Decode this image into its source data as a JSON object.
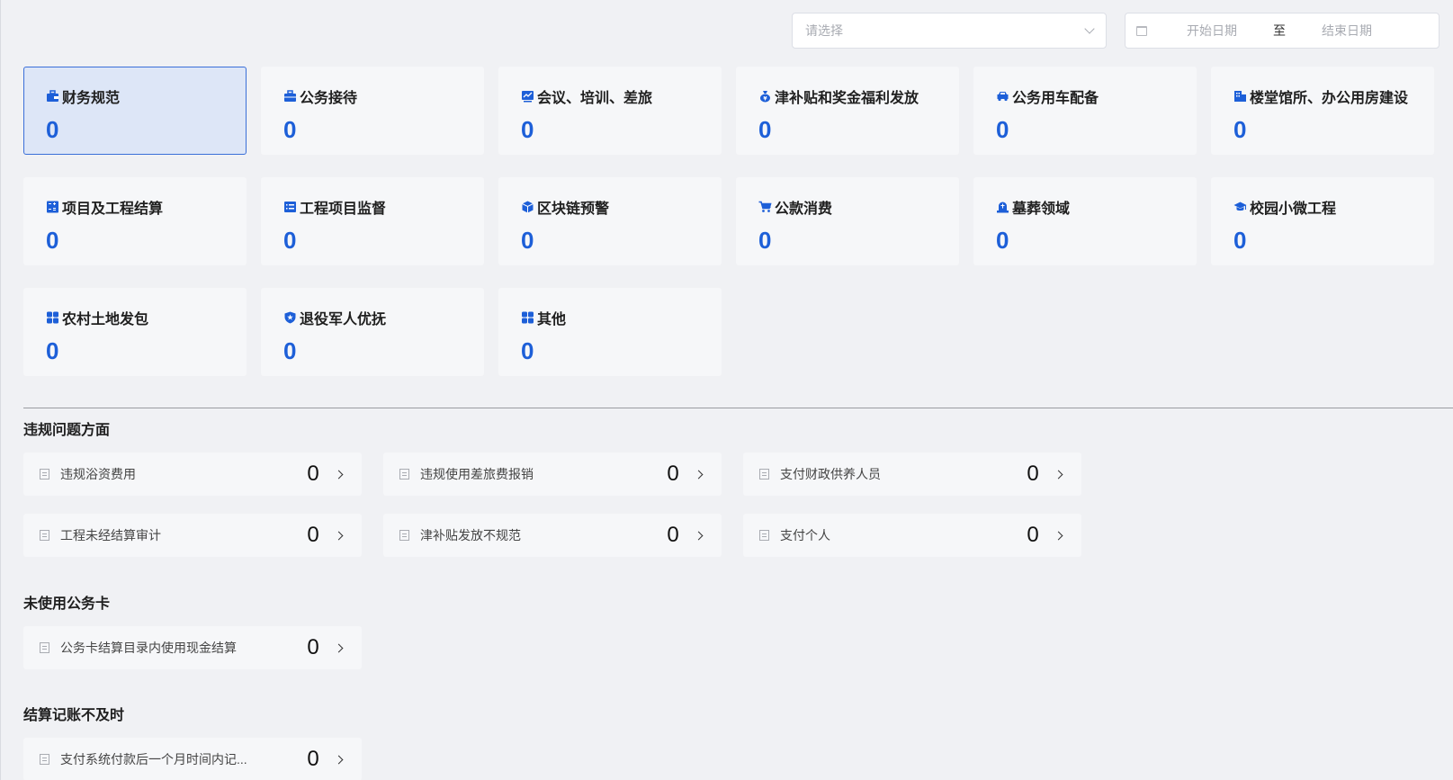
{
  "filters": {
    "select_placeholder": "请选择",
    "start_date_placeholder": "开始日期",
    "range_separator": "至",
    "end_date_placeholder": "结束日期"
  },
  "accent_color": "#1d5fd8",
  "categories": [
    {
      "label": "财务规范",
      "count": "0",
      "icon": "briefcase-icon",
      "active": true
    },
    {
      "label": "公务接待",
      "count": "0",
      "icon": "toolbox-icon"
    },
    {
      "label": "会议、培训、差旅",
      "count": "0",
      "icon": "chart-board-icon"
    },
    {
      "label": "津补贴和奖金福利发放",
      "count": "0",
      "icon": "money-bag-icon"
    },
    {
      "label": "公务用车配备",
      "count": "0",
      "icon": "car-icon"
    },
    {
      "label": "楼堂馆所、办公用房建设",
      "count": "0",
      "icon": "building-icon"
    },
    {
      "label": "项目及工程结算",
      "count": "0",
      "icon": "calculator-icon"
    },
    {
      "label": "工程项目监督",
      "count": "0",
      "icon": "list-icon"
    },
    {
      "label": "区块链预警",
      "count": "0",
      "icon": "cube-icon"
    },
    {
      "label": "公款消费",
      "count": "0",
      "icon": "cart-icon"
    },
    {
      "label": "墓葬领域",
      "count": "0",
      "icon": "tombstone-icon"
    },
    {
      "label": "校园小微工程",
      "count": "0",
      "icon": "graduation-cap-icon"
    },
    {
      "label": "农村土地发包",
      "count": "0",
      "icon": "grid-icon"
    },
    {
      "label": "退役军人优抚",
      "count": "0",
      "icon": "shield-icon"
    },
    {
      "label": "其他",
      "count": "0",
      "icon": "apps-icon"
    }
  ],
  "sections": [
    {
      "title": "违规问题方面",
      "items": [
        {
          "label": "违规浴资费用",
          "count": "0"
        },
        {
          "label": "违规使用差旅费报销",
          "count": "0"
        },
        {
          "label": "支付财政供养人员",
          "count": "0"
        },
        {
          "label": "工程未经结算审计",
          "count": "0"
        },
        {
          "label": "津补贴发放不规范",
          "count": "0"
        },
        {
          "label": "支付个人",
          "count": "0"
        }
      ]
    },
    {
      "title": "未使用公务卡",
      "items": [
        {
          "label": "公务卡结算目录内使用现金结算",
          "count": "0"
        }
      ]
    },
    {
      "title": "结算记账不及时",
      "items": [
        {
          "label": "支付系统付款后一个月时间内记...",
          "count": "0"
        }
      ]
    }
  ]
}
